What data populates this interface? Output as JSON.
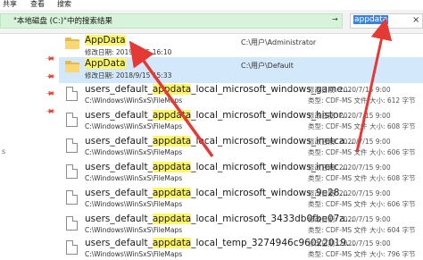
{
  "ribbon": {
    "tabs": [
      "共享",
      "查看",
      "搜索"
    ]
  },
  "address": {
    "path": "\"本地磁盘 (C:)\"中的搜索结果",
    "search_value": "appdata",
    "close_glyph": "×"
  },
  "nav": {
    "side_letter": "s"
  },
  "results": [
    {
      "type": "folder",
      "name_pre": "",
      "name_hl": "AppData",
      "name_post": "",
      "sub": "修改日期: 2019/8/25 16:10",
      "location": "C:\\用户\\Administrator",
      "meta1": "",
      "meta2": ""
    },
    {
      "type": "folder",
      "selected": true,
      "name_pre": "",
      "name_hl": "AppData",
      "name_post": "",
      "sub": "修改日期: 2018/9/15 15:33",
      "location": "C:\\用户\\Default",
      "meta1": "",
      "meta2": ""
    },
    {
      "type": "file",
      "name_pre": "users_default_",
      "name_hl": "appdata",
      "name_post": "_local_microsoft_windows_game...",
      "sub": "C:\\Windows\\WinSxS\\FileMaps",
      "location": "",
      "meta1": "修改日期: 2020/7/15 9:00",
      "meta2": "类型: CDF-MS 文件    大小: 612 字节"
    },
    {
      "type": "file",
      "name_pre": "users_default_",
      "name_hl": "appdata",
      "name_post": "_local_microsoft_windows_histor...",
      "sub": "C:\\Windows\\WinSxS\\FileMaps",
      "location": "",
      "meta1": "修改日期: 2020/7/15 9:00",
      "meta2": "类型: CDF-MS 文件    大小: 608 字节"
    },
    {
      "type": "file",
      "name_pre": "users_default_",
      "name_hl": "appdata",
      "name_post": "_local_microsoft_windows_inetca...",
      "sub": "C:\\Windows\\WinSxS\\FileMaps",
      "location": "",
      "meta1": "修改日期: 2020/7/15 9:00",
      "meta2": "类型: CDF-MS 文件    大小: 606 字节"
    },
    {
      "type": "file",
      "name_pre": "users_default_",
      "name_hl": "appdata",
      "name_post": "_local_microsoft_windows_inetc...",
      "sub": "C:\\Windows\\WinSxS\\FileMaps",
      "location": "",
      "meta1": "修改日期: 2020/7/15 9:00",
      "meta2": "类型: CDF-MS 文件    大小: 608 字节"
    },
    {
      "type": "file",
      "name_pre": "users_default_",
      "name_hl": "appdata",
      "name_post": "_local_microsoft_windows_9e28...",
      "sub": "C:\\Windows\\WinSxS\\FileMaps",
      "location": "",
      "meta1": "修改日期: 2020/7/15 9:00",
      "meta2": "类型: CDF-MS 文件    大小: 606 字节"
    },
    {
      "type": "file",
      "name_pre": "users_default_",
      "name_hl": "appdata",
      "name_post": "_local_microsoft_3433db0fbe07a...",
      "sub": "C:\\Windows\\WinSxS\\FileMaps",
      "location": "",
      "meta1": "修改日期: 2020/7/15 9:00",
      "meta2": "类型: CDF-MS 文件    大小: 604 字节"
    },
    {
      "type": "file",
      "name_pre": "users_default_",
      "name_hl": "appdata",
      "name_post": "_local_temp_3274946c96022019...",
      "sub": "C:\\Windows\\WinSxS\\FileMaps",
      "location": "",
      "meta1": "修改日期: 2020/7/15 9:00",
      "meta2": "类型: CDF-MS 文件    大小: 796 字节"
    }
  ],
  "colors": {
    "accent": "#3b82d8",
    "highlight": "#fff76a",
    "path_bg": "#d7f3d9",
    "selected_row": "#d4e8fb",
    "arrow": "#e53935"
  }
}
